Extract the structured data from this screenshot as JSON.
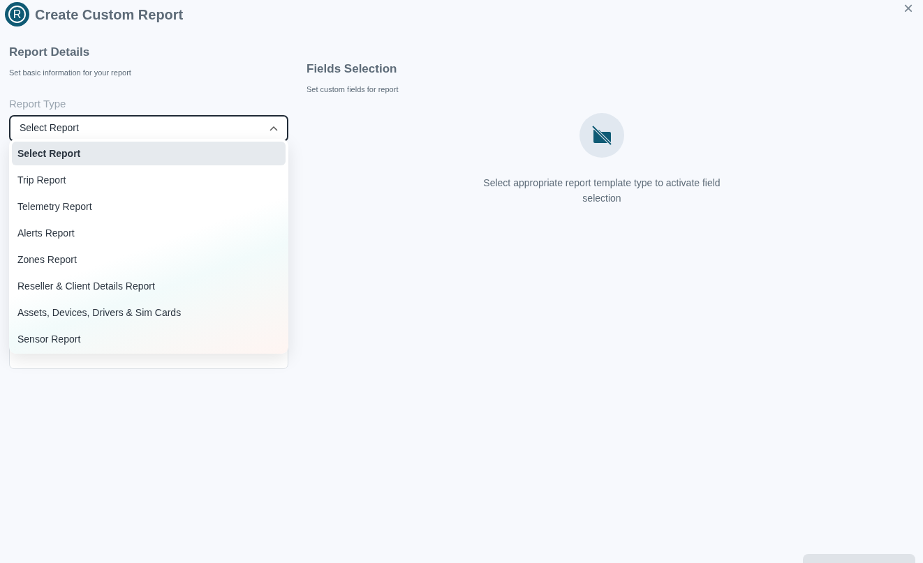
{
  "dialog": {
    "title": "Create Custom Report",
    "logo_letter": "R",
    "close": "×"
  },
  "report_details": {
    "title": "Report Details",
    "subtitle": "Set basic information for your report",
    "field_label": "Report Type",
    "value": "Select Report",
    "expanded": true,
    "options": [
      {
        "label": "Select Report",
        "selected": true
      },
      {
        "label": "Trip Report",
        "selected": false
      },
      {
        "label": "Telemetry Report",
        "selected": false
      },
      {
        "label": "Alerts Report",
        "selected": false
      },
      {
        "label": "Zones Report",
        "selected": false
      },
      {
        "label": "Reseller & Client Details Report",
        "selected": false
      },
      {
        "label": "Assets, Devices, Drivers & Sim Cards",
        "selected": false
      },
      {
        "label": "Sensor Report",
        "selected": false
      }
    ]
  },
  "fields_selection": {
    "title": "Fields Selection",
    "subtitle": "Set custom fields for report",
    "empty_message": "Select appropriate report template type to activate field selection"
  }
}
